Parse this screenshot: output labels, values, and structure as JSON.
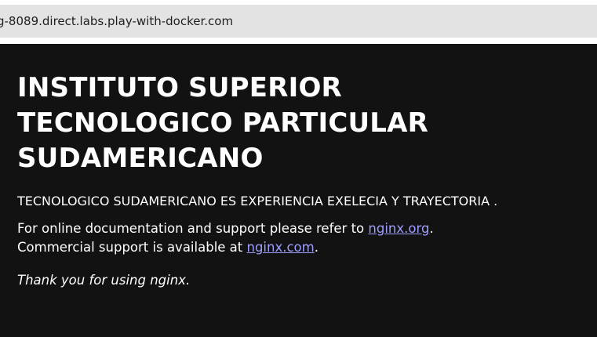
{
  "browser": {
    "address_bar_text": "g-8089.direct.labs.play-with-docker.com"
  },
  "page": {
    "heading_line1": "INSTITUTO SUPERIOR",
    "heading_line2": "TECNOLOGICO PARTICULAR",
    "heading_line3": "SUDAMERICANO",
    "tagline": "TECNOLOGICO SUDAMERICANO ES EXPERIENCIA EXELECIA Y TRAYECTORIA .",
    "docs_text_1": "For online documentation and support please refer to ",
    "docs_link_1": "nginx.org",
    "docs_text_1_end": ".",
    "docs_text_2": "Commercial support is available at ",
    "docs_link_2": "nginx.com",
    "docs_text_2_end": ".",
    "thanks": "Thank you for using nginx.",
    "colors": {
      "background": "#121212",
      "text": "#ffffff",
      "link": "#9e9eff",
      "address_bar": "#e3e3e3"
    }
  }
}
